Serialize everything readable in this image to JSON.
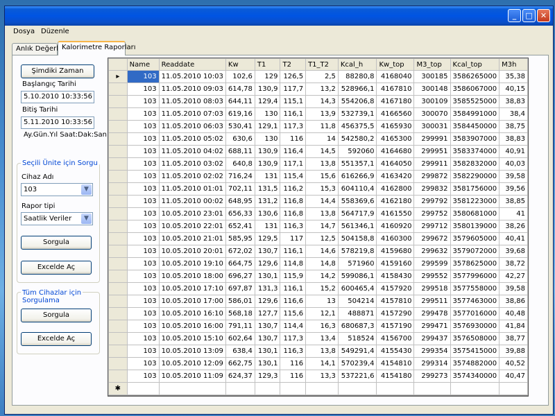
{
  "window": {
    "controls": {
      "minimize": "_",
      "maximize": "□",
      "close": "✕"
    }
  },
  "menu": [
    "Dosya",
    "Düzenle"
  ],
  "tabs": [
    {
      "label": "Anlık Değerler",
      "active": false
    },
    {
      "label": "Kalorimetre Raporları",
      "active": true
    }
  ],
  "left": {
    "now_button": "Şimdiki Zaman",
    "start_label": "Başlangıç Tarihi",
    "start_value": "5.10.2010 10:33:56",
    "end_label": "Bitiş Tarihi",
    "end_value": "5.11.2010 10:33:56",
    "format_hint": "Ay.Gün.Yıl Saat:Dak:San",
    "selected_group": {
      "title": "Seçili Ünite için Sorgu",
      "device_label": "Cihaz Adı",
      "device_value": "103",
      "report_label": "Rapor tipi",
      "report_value": "Saatlik Veriler",
      "query_button": "Sorgula",
      "excel_button": "Excelde Aç"
    },
    "all_group": {
      "title_line1": "Tüm Cihazlar için",
      "title_line2": "Sorgulama",
      "query_button": "Sorgula",
      "excel_button": "Excelde Aç"
    }
  },
  "grid": {
    "current_row_marker": "▸",
    "new_row_marker": "✱",
    "columns": [
      "Name",
      "Readdate",
      "Kw",
      "T1",
      "T2",
      "T1_T2",
      "Kcal_h",
      "Kw_top",
      "M3_top",
      "Kcal_top",
      "M3h"
    ],
    "rows": [
      [
        "103",
        "11.05.2010 10:03",
        "102,6",
        "129",
        "126,5",
        "2,5",
        "88280,8",
        "4168040",
        "300185",
        "3586265000",
        "35,38"
      ],
      [
        "103",
        "11.05.2010 09:03",
        "614,78",
        "130,9",
        "117,7",
        "13,2",
        "528966,1",
        "4167810",
        "300148",
        "3586067000",
        "40,15"
      ],
      [
        "103",
        "11.05.2010 08:03",
        "644,11",
        "129,4",
        "115,1",
        "14,3",
        "554206,8",
        "4167180",
        "300109",
        "3585525000",
        "38,83"
      ],
      [
        "103",
        "11.05.2010 07:03",
        "619,16",
        "130",
        "116,1",
        "13,9",
        "532739,1",
        "4166560",
        "300070",
        "3584991000",
        "38,4"
      ],
      [
        "103",
        "11.05.2010 06:03",
        "530,41",
        "129,1",
        "117,3",
        "11,8",
        "456375,5",
        "4165930",
        "300031",
        "3584450000",
        "38,75"
      ],
      [
        "103",
        "11.05.2010 05:02",
        "630,6",
        "130",
        "116",
        "14",
        "542580,2",
        "4165300",
        "299991",
        "3583907000",
        "38,83"
      ],
      [
        "103",
        "11.05.2010 04:02",
        "688,11",
        "130,9",
        "116,4",
        "14,5",
        "592060",
        "4164680",
        "299951",
        "3583374000",
        "40,91"
      ],
      [
        "103",
        "11.05.2010 03:02",
        "640,8",
        "130,9",
        "117,1",
        "13,8",
        "551357,1",
        "4164050",
        "299911",
        "3582832000",
        "40,03"
      ],
      [
        "103",
        "11.05.2010 02:02",
        "716,24",
        "131",
        "115,4",
        "15,6",
        "616266,9",
        "4163420",
        "299872",
        "3582290000",
        "39,58"
      ],
      [
        "103",
        "11.05.2010 01:01",
        "702,11",
        "131,5",
        "116,2",
        "15,3",
        "604110,4",
        "4162800",
        "299832",
        "3581756000",
        "39,56"
      ],
      [
        "103",
        "11.05.2010 00:02",
        "648,95",
        "131,2",
        "116,8",
        "14,4",
        "558369,6",
        "4162180",
        "299792",
        "3581223000",
        "38,85"
      ],
      [
        "103",
        "10.05.2010 23:01",
        "656,33",
        "130,6",
        "116,8",
        "13,8",
        "564717,9",
        "4161550",
        "299752",
        "3580681000",
        "41"
      ],
      [
        "103",
        "10.05.2010 22:01",
        "652,41",
        "131",
        "116,3",
        "14,7",
        "561346,1",
        "4160920",
        "299712",
        "3580139000",
        "38,26"
      ],
      [
        "103",
        "10.05.2010 21:01",
        "585,95",
        "129,5",
        "117",
        "12,5",
        "504158,8",
        "4160300",
        "299672",
        "3579605000",
        "40,41"
      ],
      [
        "103",
        "10.05.2010 20:01",
        "672,02",
        "130,7",
        "116,1",
        "14,6",
        "578219,8",
        "4159680",
        "299632",
        "3579072000",
        "39,68"
      ],
      [
        "103",
        "10.05.2010 19:10",
        "664,75",
        "129,6",
        "114,8",
        "14,8",
        "571960",
        "4159160",
        "299599",
        "3578625000",
        "38,72"
      ],
      [
        "103",
        "10.05.2010 18:00",
        "696,27",
        "130,1",
        "115,9",
        "14,2",
        "599086,1",
        "4158430",
        "299552",
        "3577996000",
        "42,27"
      ],
      [
        "103",
        "10.05.2010 17:10",
        "697,87",
        "131,3",
        "116,1",
        "15,2",
        "600465,4",
        "4157920",
        "299518",
        "3577558000",
        "39,58"
      ],
      [
        "103",
        "10.05.2010 17:00",
        "586,01",
        "129,6",
        "116,6",
        "13",
        "504214",
        "4157810",
        "299511",
        "3577463000",
        "38,86"
      ],
      [
        "103",
        "10.05.2010 16:10",
        "568,18",
        "127,7",
        "115,6",
        "12,1",
        "488871",
        "4157290",
        "299478",
        "3577016000",
        "40,48"
      ],
      [
        "103",
        "10.05.2010 16:00",
        "791,11",
        "130,7",
        "114,4",
        "16,3",
        "680687,3",
        "4157190",
        "299471",
        "3576930000",
        "41,84"
      ],
      [
        "103",
        "10.05.2010 15:10",
        "602,64",
        "130,7",
        "117,3",
        "13,4",
        "518524",
        "4156700",
        "299437",
        "3576508000",
        "38,77"
      ],
      [
        "103",
        "10.05.2010 13:09",
        "638,4",
        "130,1",
        "116,3",
        "13,8",
        "549291,4",
        "4155430",
        "299354",
        "3575415000",
        "39,88"
      ],
      [
        "103",
        "10.05.2010 12:09",
        "662,75",
        "130,1",
        "116",
        "14,1",
        "570239,4",
        "4154810",
        "299314",
        "3574882000",
        "40,52"
      ],
      [
        "103",
        "10.05.2010 11:09",
        "624,37",
        "129,3",
        "116",
        "13,3",
        "537221,6",
        "4154180",
        "299273",
        "3574340000",
        "40,47"
      ]
    ]
  }
}
